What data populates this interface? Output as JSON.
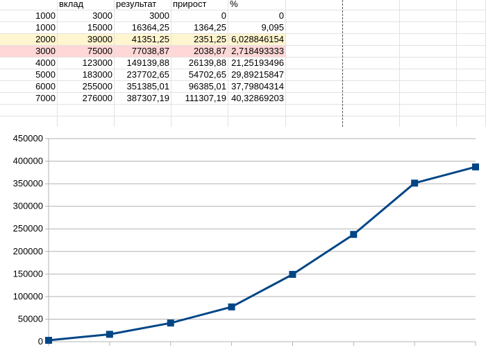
{
  "sheet": {
    "headers": [
      "",
      "вклад",
      "результат",
      "прирост",
      "%"
    ],
    "rows": [
      [
        "1000",
        "3000",
        "3000",
        "0",
        "0"
      ],
      [
        "1000",
        "15000",
        "16364,25",
        "1364,25",
        "9,095"
      ],
      [
        "2000",
        "39000",
        "41351,25",
        "2351,25",
        "6,028846154"
      ],
      [
        "3000",
        "75000",
        "77038,87",
        "2038,87",
        "2,718493333"
      ],
      [
        "4000",
        "123000",
        "149139,88",
        "26139,88",
        "21,25193496"
      ],
      [
        "5000",
        "183000",
        "237702,65",
        "54702,65",
        "29,89215847"
      ],
      [
        "6000",
        "255000",
        "351385,01",
        "96385,01",
        "37,79804314"
      ],
      [
        "7000",
        "276000",
        "387307,19",
        "111307,19",
        "40,32869203"
      ]
    ],
    "highlight": {
      "2": "#fff5ce",
      "3": "#ffd7d7"
    }
  },
  "chart_data": {
    "type": "line",
    "x": [
      1,
      2,
      3,
      4,
      5,
      6,
      7,
      8
    ],
    "series": [
      {
        "values": [
          3000,
          16364.25,
          41351.25,
          77038.87,
          149139.88,
          237702.65,
          351385.01,
          387307.19
        ],
        "color": "#004586"
      }
    ],
    "yticks": [
      "0",
      "50000",
      "100000",
      "150000",
      "200000",
      "250000",
      "300000",
      "350000",
      "400000",
      "450000"
    ],
    "ylim": [
      0,
      450000
    ],
    "grid": true,
    "legend": false,
    "marker": "square"
  }
}
